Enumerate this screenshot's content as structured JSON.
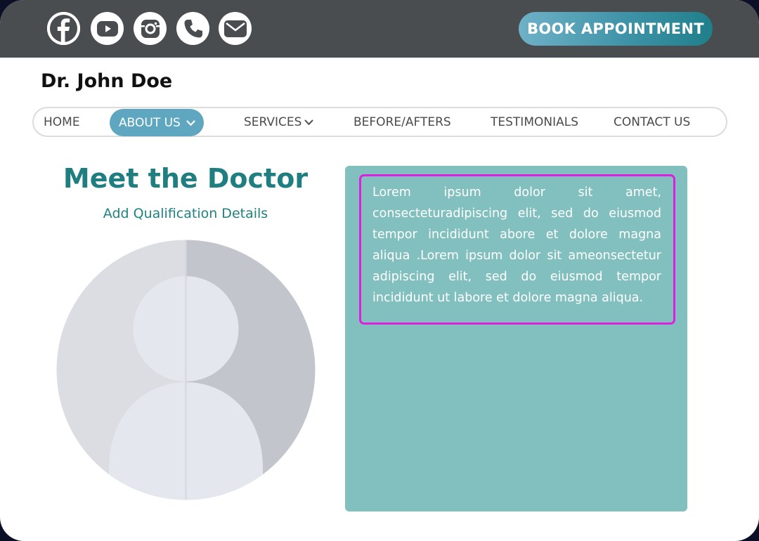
{
  "header": {
    "social_icons": [
      "facebook-icon",
      "youtube-icon",
      "instagram-icon",
      "phone-icon",
      "mail-icon"
    ],
    "cta_label": "BOOK APPOINTMENT",
    "cta_color": "#3f93a8",
    "bar_color": "#4a4d4f"
  },
  "brand": {
    "name": "Dr. John Doe"
  },
  "nav": {
    "items": [
      {
        "label": "HOME"
      },
      {
        "label": "ABOUT US"
      },
      {
        "label": "SERVICES"
      },
      {
        "label": "BEFORE/AFTERS"
      },
      {
        "label": "TESTIMONIALS"
      },
      {
        "label": "CONTACT US"
      }
    ],
    "active": "ABOUT US",
    "active_color": "#5fa7c0"
  },
  "main": {
    "title": "Meet the Doctor",
    "subtitle": "Add Qualification Details",
    "avatar_icon": "user-avatar-icon",
    "body": "Lorem ipsum dolor sit amet, consecteturadipiscing elit, sed do eiusmod tempor incididunt abore et dolore magna aliqua .Lorem ipsum dolor sit ameonsectetur adipiscing elit, sed do eiusmod tempor incididunt ut labore et dolore magna aliqua.",
    "accent_color": "#1f7f80",
    "panel_color": "#82bfbf",
    "highlight_color": "#e01ee0"
  }
}
